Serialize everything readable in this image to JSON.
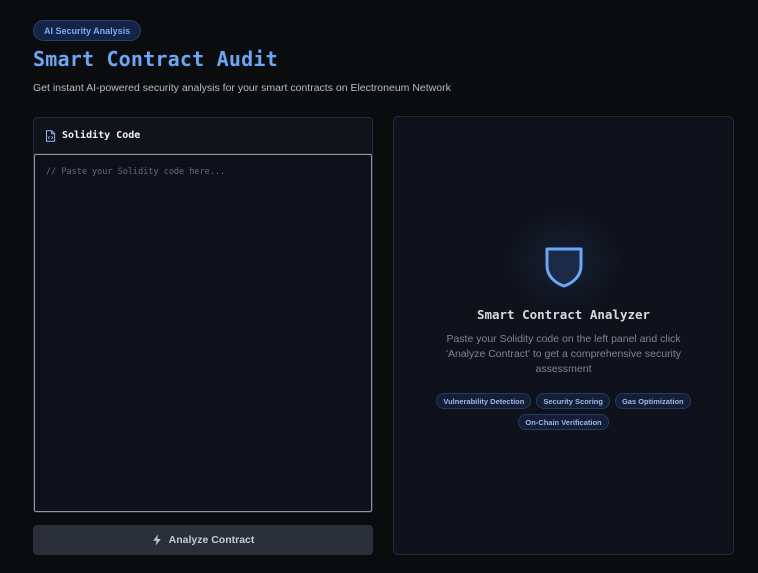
{
  "header": {
    "badge": "AI Security Analysis",
    "title": "Smart Contract Audit",
    "subtitle": "Get instant AI-powered security analysis for your smart contracts on Electroneum Network"
  },
  "editor": {
    "title": "Solidity Code",
    "icon": "file-code-icon",
    "value": "",
    "placeholder": "// Paste your Solidity code here..."
  },
  "actions": {
    "analyze_label": "Analyze Contract",
    "analyze_icon": "bolt-icon"
  },
  "analyzer": {
    "icon": "shield-icon",
    "title": "Smart Contract Analyzer",
    "description": "Paste your Solidity code on the left panel and click 'Analyze Contract' to get a comprehensive security assessment",
    "features": [
      "Vulnerability Detection",
      "Security Scoring",
      "Gas Optimization",
      "On-Chain Verification"
    ]
  },
  "colors": {
    "background": "#0b0c0e",
    "accent": "#6aa7f7",
    "panel": "#10131a",
    "button": "#2a2f39"
  }
}
